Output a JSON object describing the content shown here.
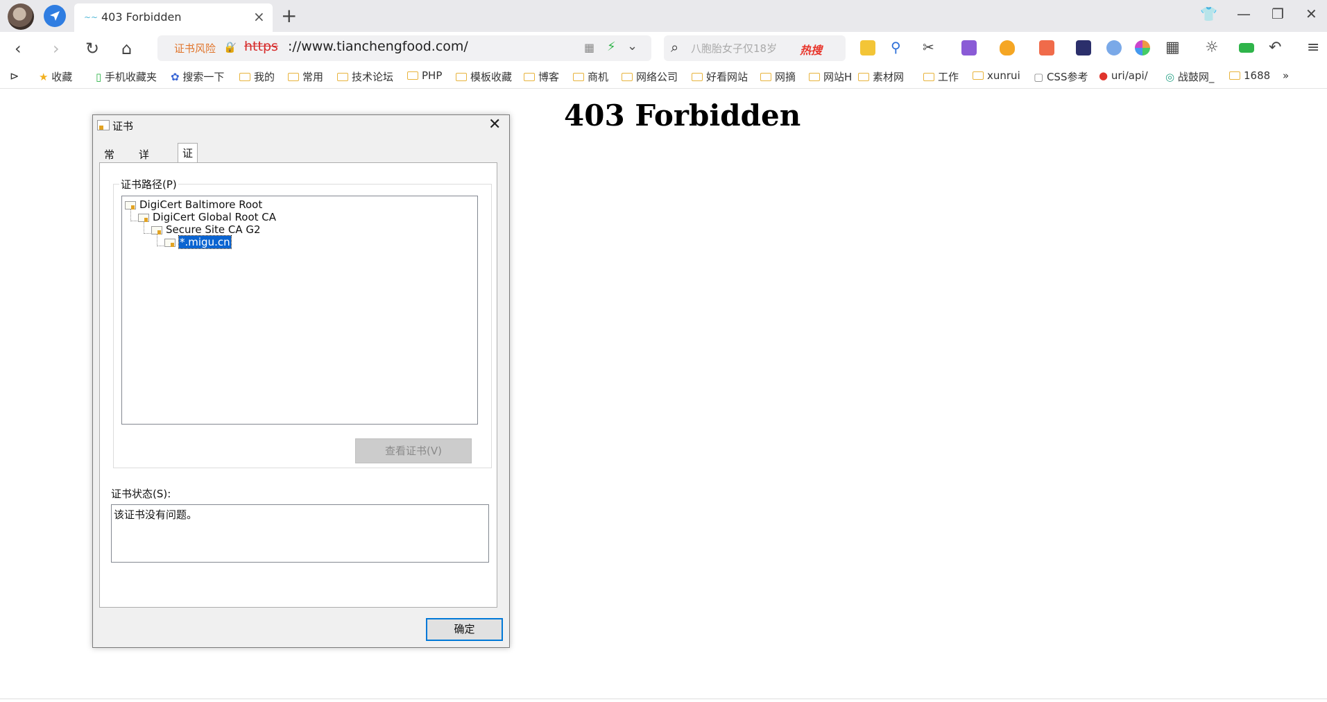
{
  "browser": {
    "tab": {
      "title": "403 Forbidden"
    },
    "address": {
      "risk_label": "证书风险",
      "url_scheme": "https",
      "url_rest": "://www.tianchengfood.com/"
    },
    "search": {
      "placeholder": "八胞胎女子仅18岁",
      "hot_label": "热搜"
    },
    "bookmarks": [
      {
        "label": "收藏",
        "type": "star"
      },
      {
        "label": "手机收藏夹",
        "type": "phone"
      },
      {
        "label": "搜索一下",
        "type": "paw"
      },
      {
        "label": "我的",
        "type": "folder"
      },
      {
        "label": "常用",
        "type": "folder"
      },
      {
        "label": "技术论坛",
        "type": "folder"
      },
      {
        "label": "PHP",
        "type": "folder"
      },
      {
        "label": "模板收藏",
        "type": "folder"
      },
      {
        "label": "博客",
        "type": "folder"
      },
      {
        "label": "商机",
        "type": "folder"
      },
      {
        "label": "网络公司",
        "type": "folder"
      },
      {
        "label": "好看网站",
        "type": "folder"
      },
      {
        "label": "网摘",
        "type": "folder"
      },
      {
        "label": "网站H",
        "type": "folder"
      },
      {
        "label": "素材网",
        "type": "folder"
      },
      {
        "label": "工作",
        "type": "folder"
      },
      {
        "label": "xunrui",
        "type": "folder"
      },
      {
        "label": "CSS参考",
        "type": "page"
      },
      {
        "label": "uri/api/",
        "type": "pin"
      },
      {
        "label": "战鼓网_",
        "type": "link"
      },
      {
        "label": "1688",
        "type": "folder"
      }
    ],
    "more_label": "»"
  },
  "page": {
    "heading": "403 Forbidden"
  },
  "dialog": {
    "title": "证书",
    "tabs": [
      "常规",
      "详细信息",
      "证书路径"
    ],
    "active_tab": 2,
    "path_group_label": "证书路径(P)",
    "tree": [
      {
        "label": "DigiCert Baltimore Root",
        "level": 0
      },
      {
        "label": "DigiCert Global Root CA",
        "level": 1
      },
      {
        "label": "Secure Site CA G2",
        "level": 2
      },
      {
        "label": "*.migu.cn",
        "level": 3,
        "selected": true
      }
    ],
    "view_cert_button": "查看证书(V)",
    "status_label": "证书状态(S):",
    "status_text": "该证书没有问题。",
    "ok_button": "确定"
  },
  "colors": {
    "accent": "#0078d7",
    "selection": "#0a64d1",
    "risk": "#e0742a",
    "hot": "#e8362c"
  },
  "icons": [
    "back-icon",
    "forward-icon",
    "reload-icon",
    "home-icon",
    "search-icon",
    "close-icon",
    "minimize-icon",
    "maximize-icon"
  ]
}
